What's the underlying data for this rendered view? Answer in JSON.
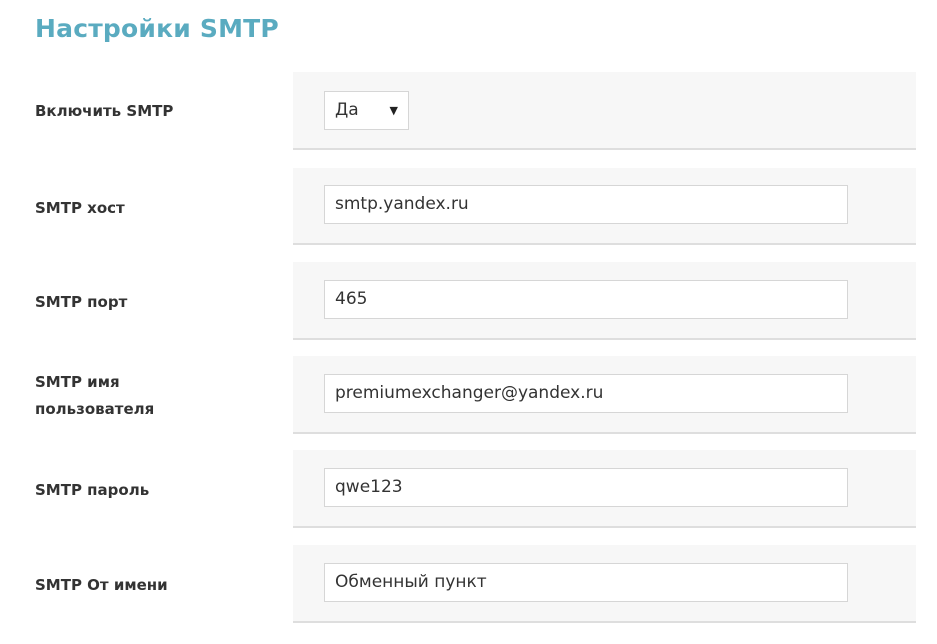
{
  "page": {
    "title": "Настройки SMTP"
  },
  "fields": [
    {
      "label": "Включить SMTP",
      "type": "select",
      "value": "Да"
    },
    {
      "label": "SMTP хост",
      "type": "text",
      "value": "smtp.yandex.ru"
    },
    {
      "label": "SMTP порт",
      "type": "text",
      "value": "465"
    },
    {
      "label_line1": "SMTP имя",
      "label_line2": "пользователя",
      "type": "text",
      "value": "premiumexchanger@yandex.ru"
    },
    {
      "label": "SMTP пароль",
      "type": "text",
      "value": "qwe123"
    },
    {
      "label": "SMTP От имени",
      "type": "text",
      "value": "Обменный пункт"
    }
  ],
  "icons": {
    "select_arrow": "chevron-down-icon"
  },
  "colors": {
    "title": "#5aabc0",
    "label": "#333333",
    "field_background": "#f7f7f7",
    "field_divider": "#dedede",
    "input_border": "#d6d6d6"
  }
}
